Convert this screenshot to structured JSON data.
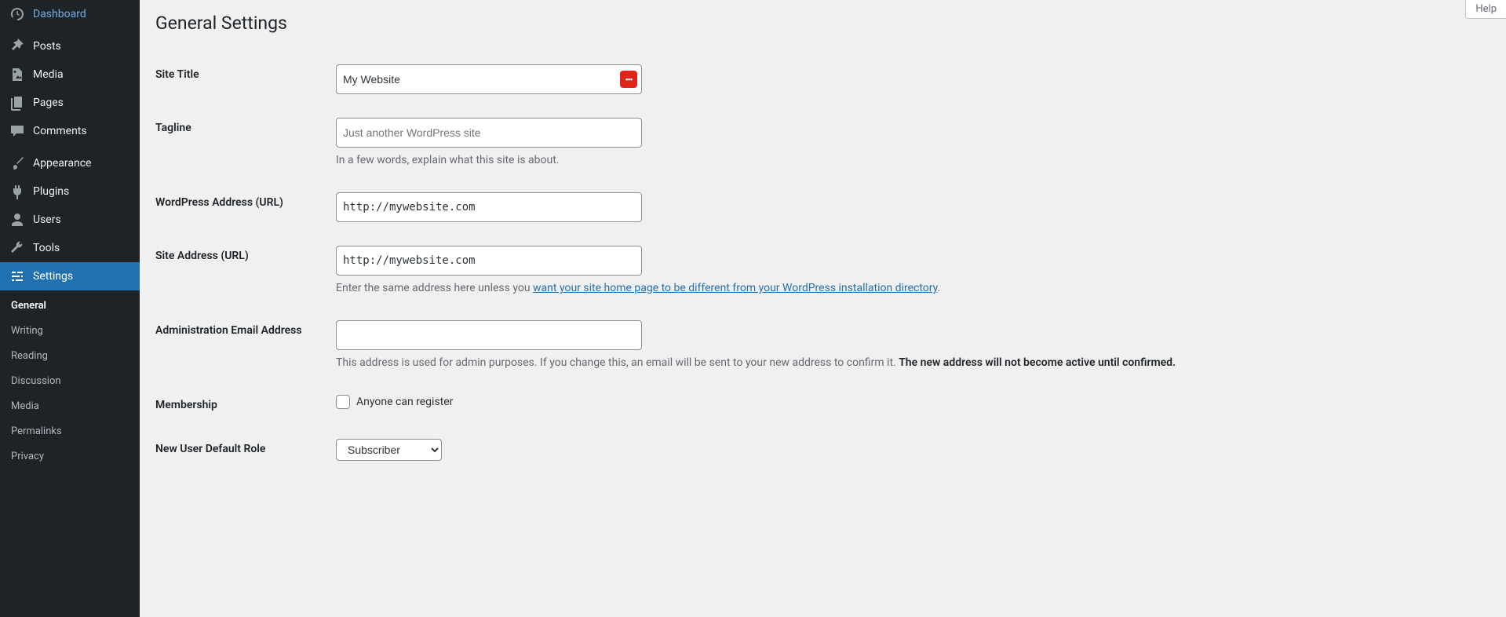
{
  "help_label": "Help",
  "sidebar": {
    "items": [
      {
        "label": "Dashboard"
      },
      {
        "label": "Posts"
      },
      {
        "label": "Media"
      },
      {
        "label": "Pages"
      },
      {
        "label": "Comments"
      },
      {
        "label": "Appearance"
      },
      {
        "label": "Plugins"
      },
      {
        "label": "Users"
      },
      {
        "label": "Tools"
      },
      {
        "label": "Settings"
      }
    ],
    "submenu": [
      {
        "label": "General"
      },
      {
        "label": "Writing"
      },
      {
        "label": "Reading"
      },
      {
        "label": "Discussion"
      },
      {
        "label": "Media"
      },
      {
        "label": "Permalinks"
      },
      {
        "label": "Privacy"
      }
    ]
  },
  "page": {
    "title": "General Settings"
  },
  "form": {
    "site_title": {
      "label": "Site Title",
      "value": "My Website"
    },
    "tagline": {
      "label": "Tagline",
      "value": "",
      "placeholder": "Just another WordPress site",
      "help": "In a few words, explain what this site is about."
    },
    "wp_url": {
      "label": "WordPress Address (URL)",
      "value": "http://mywebsite.com"
    },
    "site_url": {
      "label": "Site Address (URL)",
      "value": "http://mywebsite.com",
      "help_pre": "Enter the same address here unless you ",
      "help_link": "want your site home page to be different from your WordPress installation directory",
      "help_post": "."
    },
    "admin_email": {
      "label": "Administration Email Address",
      "value": "",
      "help_pre": "This address is used for admin purposes. If you change this, an email will be sent to your new address to confirm it. ",
      "help_strong": "The new address will not become active until confirmed."
    },
    "membership": {
      "label": "Membership",
      "checkbox_label": "Anyone can register",
      "checked": false
    },
    "default_role": {
      "label": "New User Default Role",
      "value": "Subscriber"
    }
  }
}
